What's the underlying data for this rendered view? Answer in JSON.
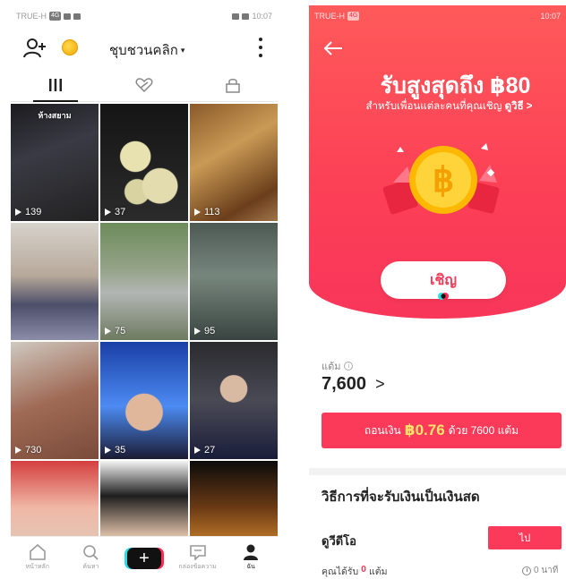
{
  "left": {
    "status": {
      "carrier": "TRUE-H",
      "time": "10:07"
    },
    "header": {
      "username": "ชุบชวนคลิก",
      "caret": "▾"
    },
    "videos": [
      {
        "views": "139",
        "caption": "ห้างสยาม"
      },
      {
        "views": "37",
        "caption": ""
      },
      {
        "views": "113",
        "caption": ""
      },
      {
        "views": "",
        "caption": ""
      },
      {
        "views": "75",
        "caption": ""
      },
      {
        "views": "95",
        "caption": ""
      },
      {
        "views": "730",
        "caption": ""
      },
      {
        "views": "35",
        "caption": ""
      },
      {
        "views": "27",
        "caption": ""
      },
      {
        "views": "",
        "caption": ""
      },
      {
        "views": "",
        "caption": ""
      },
      {
        "views": "",
        "caption": ""
      }
    ],
    "nav": [
      {
        "label": "หน้าหลัก"
      },
      {
        "label": "ค้นหา"
      },
      {
        "label": ""
      },
      {
        "label": "กล่องข้อความ"
      },
      {
        "label": "ฉัน"
      }
    ]
  },
  "right": {
    "status": {
      "carrier": "TRUE-H",
      "time": "10:07"
    },
    "hero": {
      "title": "รับสูงสุดถึง ฿80",
      "subtitle_prefix": "สำหรับเพื่อนแต่ละคนที่คุณเชิญ",
      "subtitle_link": "ดูวิธี >",
      "invite_label": "เชิญ"
    },
    "points": {
      "label": "แต้ม",
      "value": "7,600",
      "chevron": ">"
    },
    "withdraw": {
      "prefix": "ถอนเงิน",
      "amount": "฿0.76",
      "suffix": "ด้วย 7600 แต้ม"
    },
    "ways_title": "วิธีการที่จะรับเงินเป็นเงินสด",
    "task": {
      "label": "ดูวีดีโอ",
      "button": "ไป",
      "earned_prefix": "คุณได้รับ",
      "earned_value": "0",
      "earned_suffix": "แต้ม",
      "timer": "0 นาที"
    },
    "colors": {
      "accent": "#fb3a59",
      "hero": "#fc3f56"
    }
  }
}
